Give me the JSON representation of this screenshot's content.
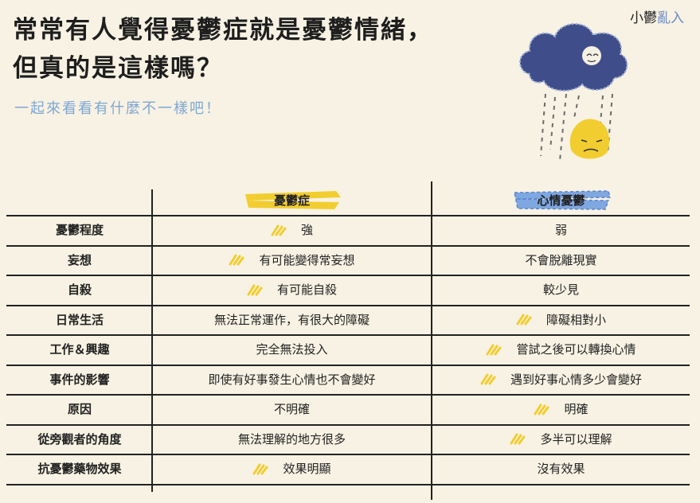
{
  "title": {
    "line1": "常常有人覺得憂鬱症就是憂鬱情緒，",
    "line2": "但真的是這樣嗎？"
  },
  "subtitle": "一起來看看有什麼不一樣吧！",
  "brand": {
    "part1": "小",
    "part2": "鬱",
    "part3": "亂",
    "part4": "入"
  },
  "columns": {
    "depression": "憂鬱症",
    "mood": "心情憂鬱"
  },
  "colors": {
    "yellow": "#f2cd2f",
    "blue": "#6a8cc6",
    "ink": "#222222"
  },
  "rows": [
    {
      "label": "憂鬱程度",
      "depression": "強",
      "mood": "弱",
      "mark": "depression"
    },
    {
      "label": "妄想",
      "depression": "有可能變得常妄想",
      "mood": "不會脫離現實",
      "mark": "depression"
    },
    {
      "label": "自殺",
      "depression": "有可能自殺",
      "mood": "較少見",
      "mark": "depression"
    },
    {
      "label": "日常生活",
      "depression": "無法正常運作，有很大的障礙",
      "mood": "障礙相對小",
      "mark": "mood"
    },
    {
      "label": "工作＆興趣",
      "depression": "完全無法投入",
      "mood": "嘗試之後可以轉換心情",
      "mark": "mood"
    },
    {
      "label": "事件的影響",
      "depression": "即使有好事發生心情也不會變好",
      "mood": "遇到好事心情多少會變好",
      "mark": "mood"
    },
    {
      "label": "原因",
      "depression": "不明確",
      "mood": "明確",
      "mark": "mood"
    },
    {
      "label": "從旁觀者的角度",
      "depression": "無法理解的地方很多",
      "mood": "多半可以理解",
      "mark": "mood"
    },
    {
      "label": "抗憂鬱藥物效果",
      "depression": "效果明顯",
      "mood": "沒有效果",
      "mark": "depression"
    }
  ]
}
